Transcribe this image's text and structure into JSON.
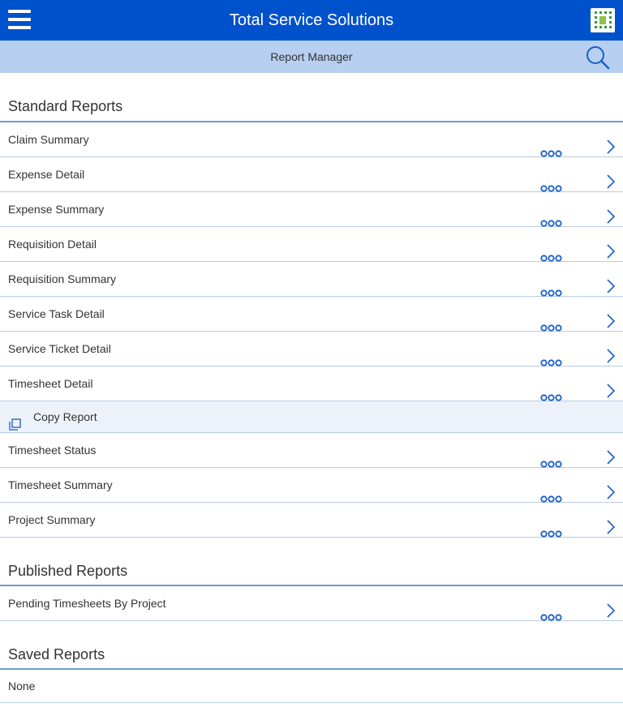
{
  "header": {
    "title": "Total Service Solutions",
    "menu_icon": "hamburger-menu-icon",
    "logo_icon": "company-logo-icon"
  },
  "subheader": {
    "title": "Report Manager",
    "search_icon": "search-icon"
  },
  "colors": {
    "primary": "#0052cc",
    "subbar": "#b7cff0",
    "accent_blue": "#1a5fc9",
    "divider": "#b8cce6",
    "highlight_row": "#edf2fa"
  },
  "standard_reports": {
    "title": "Standard Reports",
    "items": [
      {
        "label": "Claim Summary"
      },
      {
        "label": "Expense Detail"
      },
      {
        "label": "Expense Summary"
      },
      {
        "label": "Requisition Detail"
      },
      {
        "label": "Requisition Summary"
      },
      {
        "label": "Service Task Detail"
      },
      {
        "label": "Service Ticket Detail"
      },
      {
        "label": "Timesheet Detail"
      }
    ],
    "copy_action": {
      "label": "Copy Report",
      "icon": "copy-icon"
    },
    "items_after": [
      {
        "label": "Timesheet Status"
      },
      {
        "label": "Timesheet Summary"
      },
      {
        "label": "Project Summary"
      }
    ]
  },
  "published_reports": {
    "title": "Published Reports",
    "items": [
      {
        "label": "Pending Timesheets By Project"
      }
    ]
  },
  "saved_reports": {
    "title": "Saved Reports",
    "empty_text": "None"
  }
}
